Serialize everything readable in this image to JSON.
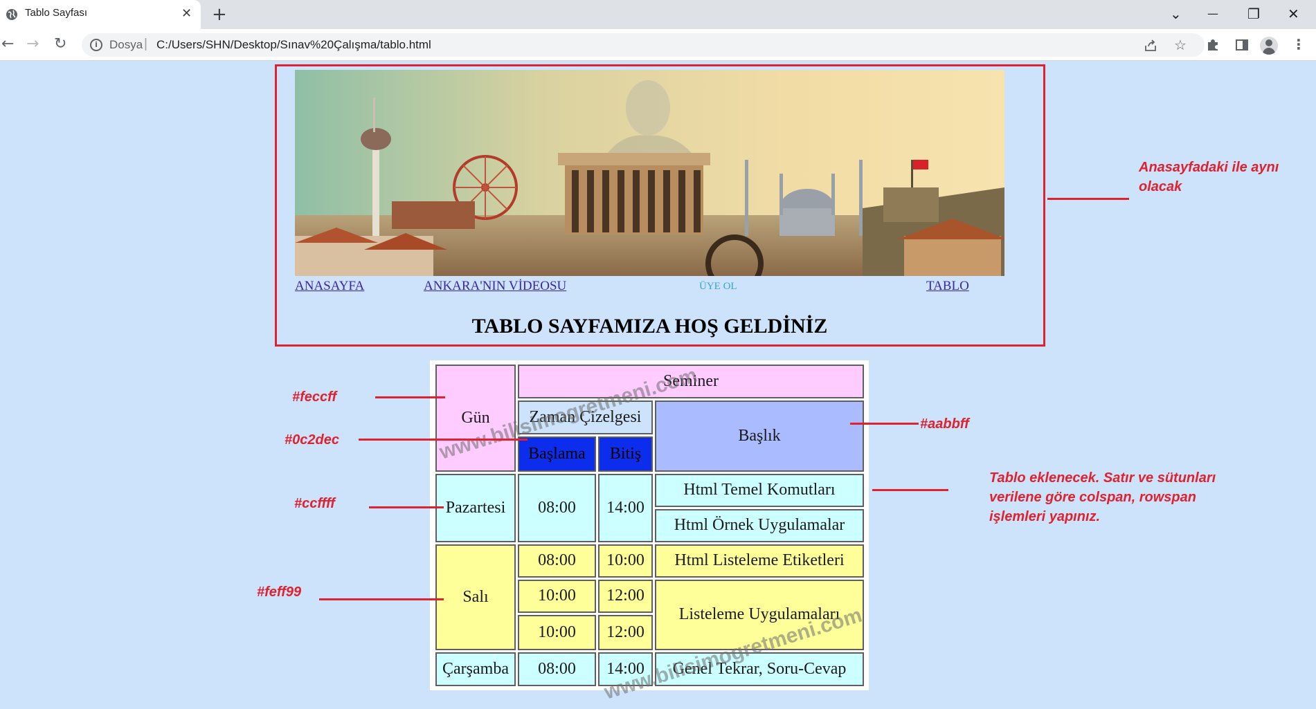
{
  "browser": {
    "tab_title": "Tablo Sayfası",
    "tab_close": "✕",
    "new_tab": "+",
    "window_controls": {
      "tab_search": "⌄",
      "minimize": "—",
      "restore": "❐",
      "close": "✕"
    },
    "nav": {
      "back": "←",
      "forward": "→",
      "reload": "↻"
    },
    "url_scheme": "Dosya",
    "url_separator": "|",
    "url": "C:/Users/SHN/Desktop/Sınav%20Çalışma/tablo.html",
    "icons": [
      "info-icon",
      "share-icon",
      "bookmark-star-icon",
      "extensions-puzzle-icon",
      "side-panel-icon",
      "profile-avatar-icon",
      "menu-kebab-icon"
    ]
  },
  "header": {
    "nav_links": [
      "ANASAYFA",
      "ANKARA'NIN VİDEOSU",
      "ÜYE OL",
      "TABLO"
    ],
    "welcome": "TABLO SAYFAMIZA HOŞ GELDİNİZ"
  },
  "table": {
    "headers": {
      "day": "Gün",
      "seminar": "Seminer",
      "timeline": "Zaman Çizelgesi",
      "start": "Başlama",
      "end": "Bitiş",
      "topic": "Başlık"
    },
    "rows": {
      "monday": {
        "day": "Pazartesi",
        "start": "08:00",
        "end": "14:00",
        "topics": [
          "Html Temel Komutları",
          "Html Örnek Uygulamalar"
        ]
      },
      "tuesday": {
        "day": "Salı",
        "slots": [
          {
            "start": "08:00",
            "end": "10:00"
          },
          {
            "start": "10:00",
            "end": "12:00"
          },
          {
            "start": "10:00",
            "end": "12:00"
          }
        ],
        "topics": [
          "Html Listeleme Etiketleri",
          "Listeleme Uygulamaları"
        ]
      },
      "wednesday": {
        "day": "Çarşamba",
        "start": "08:00",
        "end": "14:00",
        "topic": "Genel Tekrar, Soru-Cevap"
      }
    },
    "watermark": "www.bilisimogretmeni.com"
  },
  "colors": {
    "header_pink": "#feccff",
    "sub_header_blue": "#0c2dec",
    "topic_header": "#aabbff",
    "monday_cyan": "#ccffff",
    "tuesday_yellow": "#feff99",
    "annotation_red": "#e0222e",
    "page_background": "#cce3fb"
  },
  "annotations": {
    "header_note": [
      "Anasayfadaki ile aynı",
      "olacak"
    ],
    "pink": "#feccff",
    "blue": "#0c2dec",
    "topic": "#aabbff",
    "cyan": "#ccffff",
    "yellow": "#feff99",
    "table_note": [
      "Tablo eklenecek. Satır ve sütunları",
      "verilene göre colspan, rowspan",
      "işlemleri yapınız."
    ]
  }
}
